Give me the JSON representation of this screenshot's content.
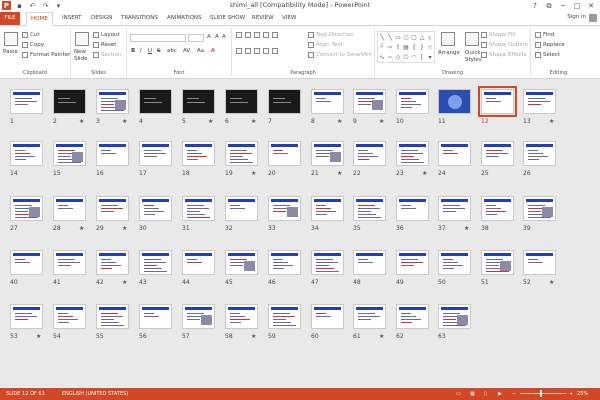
{
  "title": "shimi_all [Compatibility Mode] - PowerPoint",
  "qat": {
    "logo_glyph": "P",
    "save_glyph": "▪",
    "undo_glyph": "↶",
    "redo_glyph": "↷",
    "customize_glyph": "▾"
  },
  "window": {
    "help": "?",
    "restore": "⧉",
    "minimize": "─",
    "maximize": "□",
    "close": "✕"
  },
  "tabs": [
    "FILE",
    "HOME",
    "INSERT",
    "DESIGN",
    "TRANSITIONS",
    "ANIMATIONS",
    "SLIDE SHOW",
    "REVIEW",
    "VIEW"
  ],
  "active_tab": "HOME",
  "signin": "Sign in",
  "ribbon": {
    "clipboard": {
      "label": "Clipboard",
      "paste": "Paste",
      "cut": "Cut",
      "copy": "Copy",
      "format_painter": "Format Painter"
    },
    "slides": {
      "label": "Slides",
      "new_slide": "New",
      "new_slide_line2": "Slide",
      "layout": "Layout",
      "reset": "Reset",
      "section": "Section"
    },
    "font": {
      "label": "Font",
      "bold": "B",
      "italic": "I",
      "underline": "U",
      "strike": "S",
      "shadow": "abc",
      "spacing": "AV",
      "case": "Aa",
      "color": "A"
    },
    "paragraph": {
      "label": "Paragraph",
      "text_direction": "Text Direction",
      "align_text": "Align Text",
      "convert_smartart": "Convert to SmartArt"
    },
    "drawing": {
      "label": "Drawing",
      "arrange": "Arrange",
      "quick_styles": "Quick",
      "quick_styles_line2": "Styles",
      "shape_fill": "Shape Fill",
      "shape_outline": "Shape Outline",
      "shape_effects": "Shape Effects"
    },
    "editing": {
      "label": "Editing",
      "find": "Find",
      "replace": "Replace",
      "select": "Select"
    }
  },
  "slides": [
    {
      "num": "1",
      "star": false
    },
    {
      "num": "2",
      "star": true
    },
    {
      "num": "3",
      "star": true
    },
    {
      "num": "4",
      "star": false
    },
    {
      "num": "5",
      "star": true
    },
    {
      "num": "6",
      "star": true
    },
    {
      "num": "7",
      "star": false
    },
    {
      "num": "8",
      "star": true
    },
    {
      "num": "9",
      "star": true
    },
    {
      "num": "10",
      "star": false
    },
    {
      "num": "11",
      "star": false
    },
    {
      "num": "12",
      "star": false
    },
    {
      "num": "13",
      "star": true
    },
    {
      "num": "14",
      "star": false
    },
    {
      "num": "15",
      "star": false
    },
    {
      "num": "16",
      "star": false
    },
    {
      "num": "17",
      "star": false
    },
    {
      "num": "18",
      "star": false
    },
    {
      "num": "19",
      "star": true
    },
    {
      "num": "20",
      "star": false
    },
    {
      "num": "21",
      "star": true
    },
    {
      "num": "22",
      "star": false
    },
    {
      "num": "23",
      "star": true
    },
    {
      "num": "24",
      "star": false
    },
    {
      "num": "25",
      "star": false
    },
    {
      "num": "26",
      "star": false
    },
    {
      "num": "27",
      "star": false
    },
    {
      "num": "28",
      "star": true
    },
    {
      "num": "29",
      "star": true
    },
    {
      "num": "30",
      "star": false
    },
    {
      "num": "31",
      "star": false
    },
    {
      "num": "32",
      "star": false
    },
    {
      "num": "33",
      "star": false
    },
    {
      "num": "34",
      "star": false
    },
    {
      "num": "35",
      "star": false
    },
    {
      "num": "36",
      "star": false
    },
    {
      "num": "37",
      "star": true
    },
    {
      "num": "38",
      "star": false
    },
    {
      "num": "39",
      "star": false
    },
    {
      "num": "40",
      "star": false
    },
    {
      "num": "41",
      "star": false
    },
    {
      "num": "42",
      "star": true
    },
    {
      "num": "43",
      "star": false
    },
    {
      "num": "44",
      "star": false
    },
    {
      "num": "45",
      "star": false
    },
    {
      "num": "46",
      "star": false
    },
    {
      "num": "47",
      "star": false
    },
    {
      "num": "48",
      "star": false
    },
    {
      "num": "49",
      "star": false
    },
    {
      "num": "50",
      "star": false
    },
    {
      "num": "51",
      "star": false
    },
    {
      "num": "52",
      "star": true
    },
    {
      "num": "53",
      "star": true
    },
    {
      "num": "54",
      "star": false
    },
    {
      "num": "55",
      "star": false
    },
    {
      "num": "56",
      "star": false
    },
    {
      "num": "57",
      "star": false
    },
    {
      "num": "58",
      "star": true
    },
    {
      "num": "59",
      "star": false
    },
    {
      "num": "60",
      "star": false
    },
    {
      "num": "61",
      "star": true
    },
    {
      "num": "62",
      "star": false
    },
    {
      "num": "63",
      "star": false
    }
  ],
  "selected_slide": "12",
  "star_glyph": "★",
  "status": {
    "slide": "SLIDE 12 OF 63",
    "language": "ENGLISH (UNITED STATES)",
    "zoom": "25%",
    "zoom_out": "−",
    "zoom_in": "+"
  },
  "colors": {
    "accent": "#d24726",
    "slide_header": "#1f3fbf"
  }
}
